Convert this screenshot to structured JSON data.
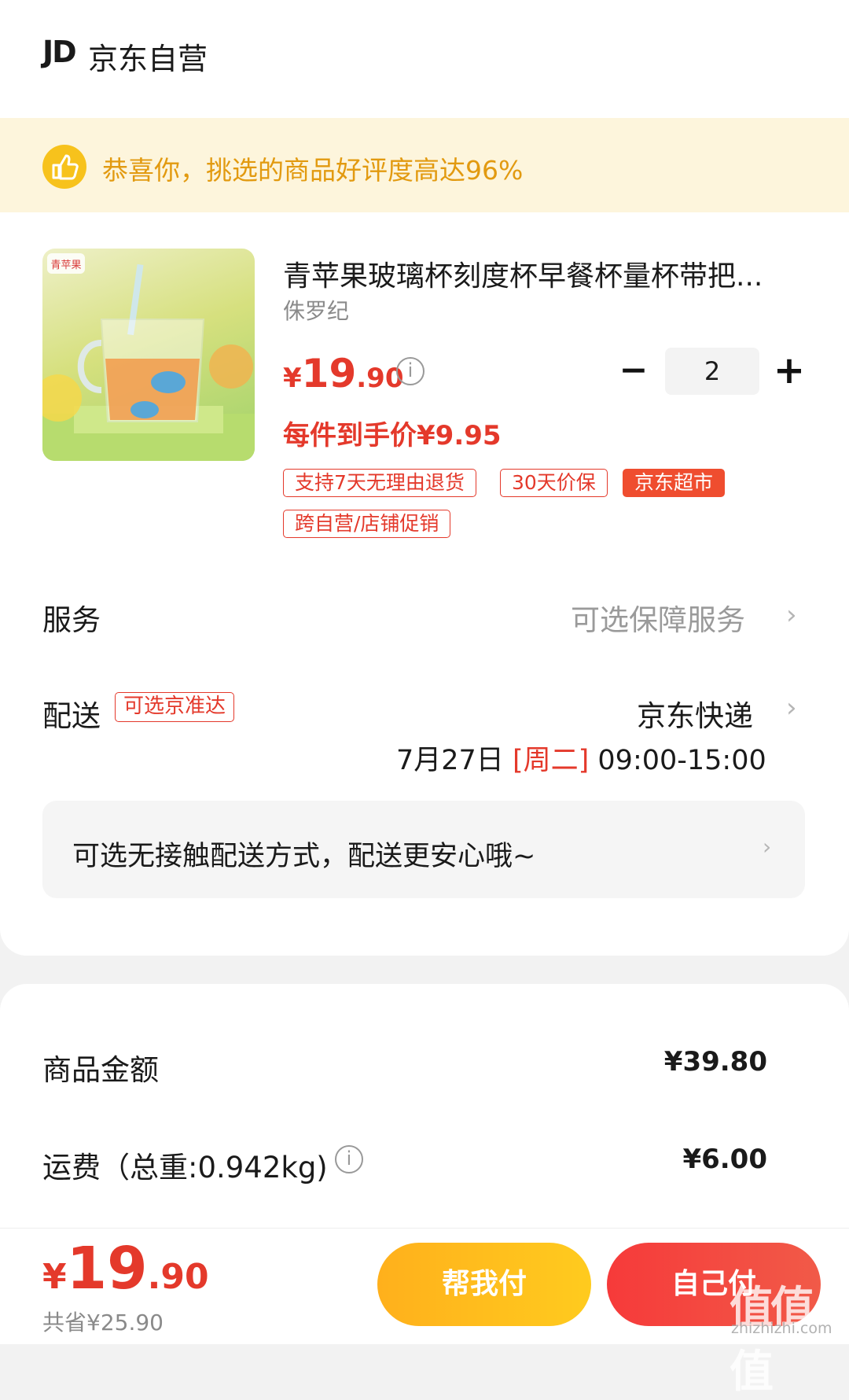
{
  "header": {
    "logo": "JD",
    "store": "京东自营"
  },
  "banner": {
    "text": "恭喜你，挑选的商品好评度高达96%",
    "icon": "thumbs-up-icon"
  },
  "product": {
    "title": "青苹果玻璃杯刻度杯早餐杯量杯带把...",
    "brand": "侏罗纪",
    "image_label": "青苹果",
    "price_currency": "¥",
    "price_int": "19",
    "price_dec": ".90",
    "unit_price": "每件到手价¥9.95",
    "quantity": "2",
    "minus": "−",
    "plus": "+",
    "tags": [
      "支持7天无理由退货",
      "30天价保",
      "京东超市",
      "跨自营/店铺促销"
    ]
  },
  "service": {
    "label": "服务",
    "value": "可选保障服务"
  },
  "delivery": {
    "label": "配送",
    "badge": "可选京准达",
    "carrier": "京东快递",
    "date": "7月27日",
    "weekday": "[周二]",
    "time": "09:00-15:00",
    "contactless": "可选无接触配送方式，配送更安心哦~"
  },
  "summary": {
    "goods_label": "商品金额",
    "goods_value": "¥39.80",
    "shipping_label": "运费（总重:0.942kg)",
    "shipping_value": "¥6.00"
  },
  "footer": {
    "total_currency": "¥",
    "total_int": "19",
    "total_dec": ".90",
    "saved": "共省¥25.90",
    "help_pay": "帮我付",
    "self_pay": "自己付",
    "watermark": "值值值",
    "watermark_sub": "zhizhizhi.com"
  },
  "colors": {
    "accent_red": "#e4392b",
    "banner_bg": "#fdf5dc",
    "banner_text": "#e29a10",
    "help_btn": "#ffb01c",
    "self_btn": "#f63a3a"
  }
}
